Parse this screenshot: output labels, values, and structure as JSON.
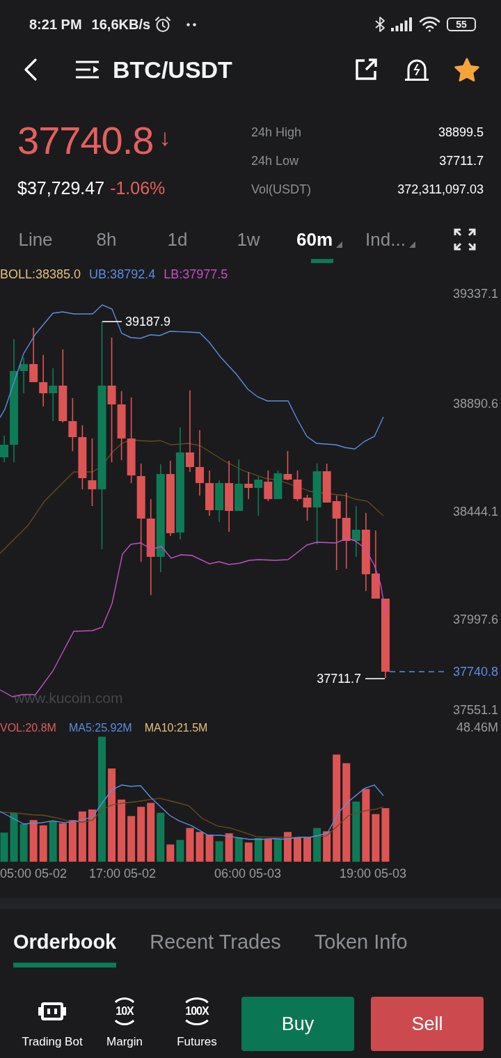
{
  "status_bar": {
    "time": "8:21 PM",
    "speed": "16,6KB/s",
    "battery": "55"
  },
  "header": {
    "title": "BTC/USDT",
    "favorite": true
  },
  "ticker": {
    "price": "37740.8",
    "trend_arrow": "↓",
    "falling": true,
    "usd_price": "$37,729.47",
    "change": "-1.06%",
    "stats": [
      {
        "label": "24h High",
        "value": "38899.5"
      },
      {
        "label": "24h Low",
        "value": "37711.7"
      },
      {
        "label": "Vol(USDT)",
        "value": "372,311,097.03"
      }
    ]
  },
  "periods": [
    {
      "label": "Line",
      "selected": false,
      "dropdown": false
    },
    {
      "label": "8h",
      "selected": false,
      "dropdown": false
    },
    {
      "label": "1d",
      "selected": false,
      "dropdown": false
    },
    {
      "label": "1w",
      "selected": false,
      "dropdown": false
    },
    {
      "label": "60m",
      "selected": true,
      "dropdown": true
    },
    {
      "label": "Ind...",
      "selected": false,
      "dropdown": true
    }
  ],
  "chart": {
    "legend": [
      {
        "text": "BOLL:38385.0",
        "color": "#e2be84"
      },
      {
        "text": "UB:38792.4",
        "color": "#5b8de3"
      },
      {
        "text": "LB:37977.5",
        "color": "#c84ec8"
      }
    ],
    "y_labels": [
      "39337.1",
      "38890.6",
      "38444.1",
      "37997.6",
      "37551.1"
    ],
    "high_marker": "39187.9",
    "low_marker": "37711.7",
    "last_price": "37740.8",
    "watermark": "www.kucoin.com"
  },
  "volume": {
    "legend": [
      {
        "text": "VOL:20.8M",
        "color": "#e05c5c"
      },
      {
        "text": "MA5:25.92M",
        "color": "#5b8de3"
      },
      {
        "text": "MA10:21.5M",
        "color": "#e8c07d"
      }
    ],
    "max_label": "48.46M",
    "time_labels": [
      "05:00 05-02",
      "17:00 05-02",
      "06:00 05-03",
      "19:00 05-03"
    ]
  },
  "tabs": [
    {
      "label": "Orderbook",
      "selected": true
    },
    {
      "label": "Recent Trades",
      "selected": false
    },
    {
      "label": "Token Info",
      "selected": false
    }
  ],
  "shortcuts": [
    {
      "kind": "bot",
      "label": "Trading Bot"
    },
    {
      "kind": "leverage",
      "badge": "10X",
      "label": "Margin"
    },
    {
      "kind": "leverage",
      "badge": "100X",
      "label": "Futures"
    }
  ],
  "actions": [
    {
      "kind": "buy",
      "label": "Buy"
    },
    {
      "kind": "sell",
      "label": "Sell"
    }
  ]
}
